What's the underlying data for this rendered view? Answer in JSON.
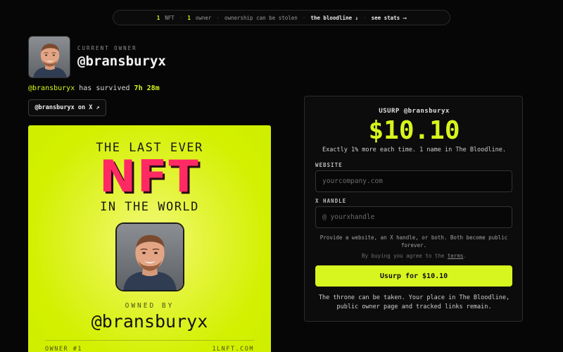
{
  "topbar": {
    "nft_count": "1",
    "nft_label": "NFT",
    "owner_count": "1",
    "owner_label": "owner",
    "stolen_text": "ownership can be stolen",
    "bloodline_link": "the bloodline ↓",
    "stats_link": "see stats ⟶"
  },
  "owner": {
    "caption": "CURRENT OWNER",
    "handle": "@bransburyx",
    "survived_handle": "@bransburyx",
    "survived_text": "has survived",
    "survived_time": "7h 28m",
    "x_link": "@bransburyx on X ↗"
  },
  "card": {
    "line1": "THE LAST EVER",
    "nft": "NFT",
    "line2": "IN THE WORLD",
    "owned_by": "OWNED BY",
    "handle": "@bransburyx",
    "footer_left": "OWNER #1",
    "footer_right": "1LNFT.COM"
  },
  "panel": {
    "caption": "USURP @bransburyx",
    "price": "$10.10",
    "subtitle": "Exactly 1% more each time. 1 name in The Bloodline.",
    "website_label": "WEBSITE",
    "website_placeholder": "yourcompany.com",
    "xhandle_label": "X HANDLE",
    "xhandle_placeholder": "@ yourxhandle",
    "helper": "Provide a website, an X handle, or both. Both become public forever.",
    "terms_prefix": "By buying you agree to the",
    "terms_link": "terms",
    "terms_suffix": ".",
    "buy_button": "Usurp for $10.10",
    "footer": "The throne can be taken. Your place in The Bloodline, public owner page and tracked links remain."
  },
  "colors": {
    "accent": "#d7f51e",
    "nft_pink": "#ff2a64",
    "background": "#060606"
  },
  "icons": {
    "external_link": "arrow-up-right-icon",
    "down_arrow": "arrow-down-icon",
    "right_arrow": "arrow-right-icon"
  }
}
